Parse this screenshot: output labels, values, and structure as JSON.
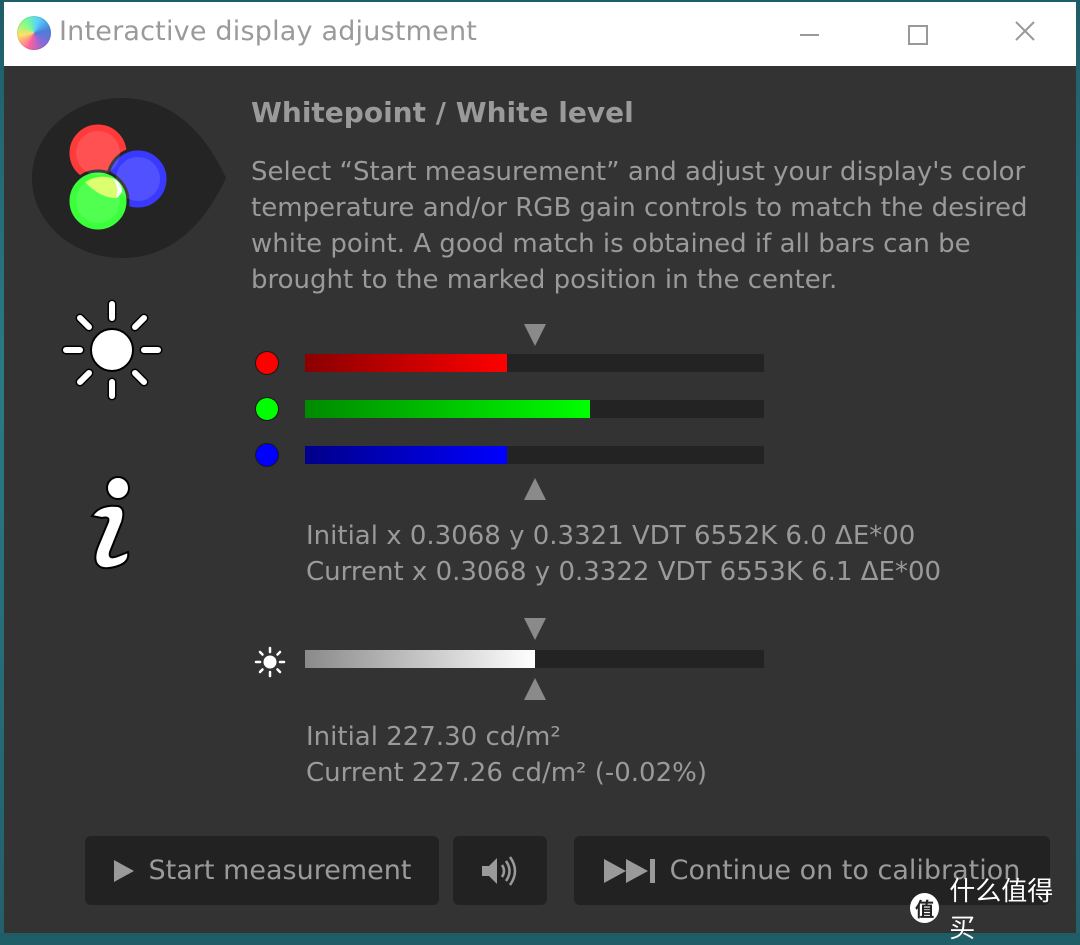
{
  "window": {
    "title": "Interactive display adjustment",
    "controls": {
      "minimize": "minimize",
      "maximize": "maximize",
      "close": "close"
    }
  },
  "sidebar": {
    "icons": [
      "rgb-circles-icon",
      "brightness-sun-icon",
      "info-icon"
    ]
  },
  "content": {
    "heading": "Whitepoint / White level",
    "description": "Select “Start measurement” and adjust your display's color temperature and/or RGB gain controls to match the desired white point. A good match is obtained if all bars can be brought to the marked position in the center."
  },
  "rgb_bars": {
    "target_fraction": 0.5,
    "channels": [
      {
        "name": "red",
        "color": "#ff0000",
        "fraction": 0.44
      },
      {
        "name": "green",
        "color": "#00ff00",
        "fraction": 0.62
      },
      {
        "name": "blue",
        "color": "#0000ff",
        "fraction": 0.44
      }
    ],
    "initial": "Initial x 0.3068 y 0.3321 VDT 6552K 6.0 ΔE*00",
    "current": "Current x 0.3068 y 0.3322 VDT 6553K 6.1 ΔE*00"
  },
  "luminance_bar": {
    "target_fraction": 0.5,
    "fraction": 0.5,
    "initial": "Initial 227.30 cd/m²",
    "current": "Current 227.26 cd/m² (-0.02%)"
  },
  "buttons": {
    "start": {
      "label": "Start measurement",
      "icon": "play-icon"
    },
    "sound": {
      "icon": "speaker-icon"
    },
    "continue": {
      "label": "Continue on to calibration",
      "icon": "skip-forward-icon"
    }
  },
  "watermark": {
    "badge": "值",
    "text": "什么值得买"
  },
  "colors": {
    "background": "#333333",
    "text": "#9a9a9a",
    "button": "#222222",
    "track": "#232323"
  }
}
